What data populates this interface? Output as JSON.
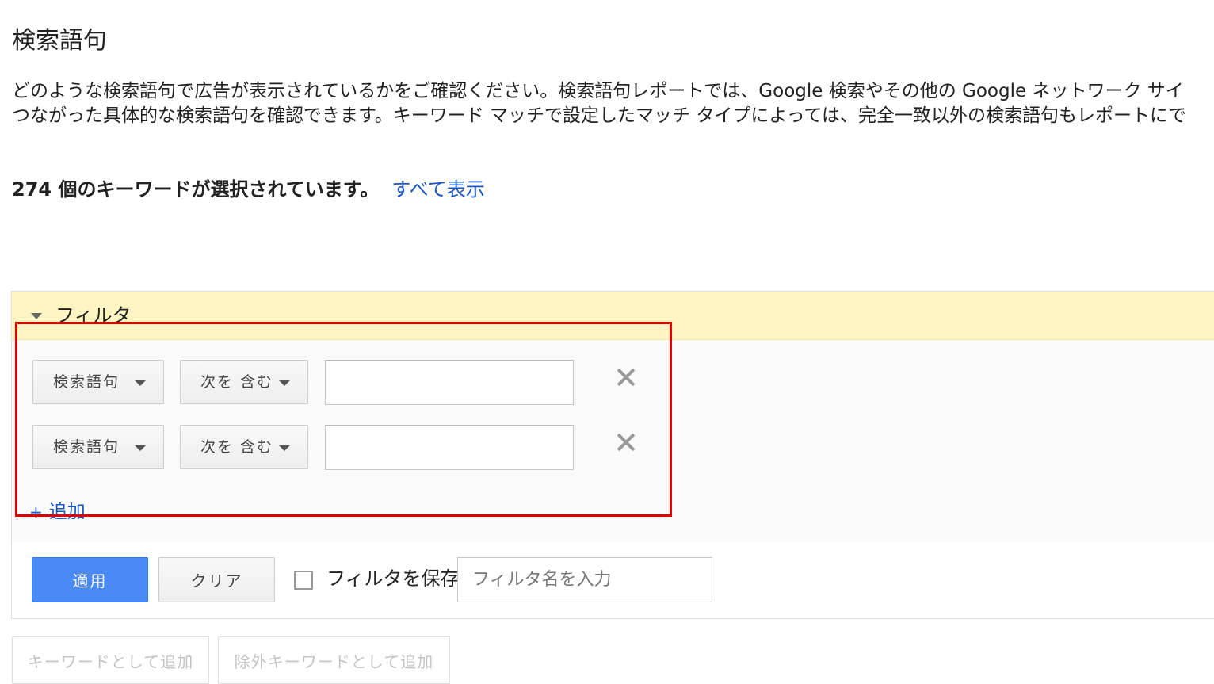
{
  "page": {
    "title": "検索語句",
    "description_lines": [
      "どのような検索語句で広告が表示されているかをご確認ください。検索語句レポートでは、Google 検索やその他の Google ネットワーク サイ",
      "つながった具体的な検索語句を確認できます。キーワード マッチで設定したマッチ タイプによっては、完全一致以外の検索語句もレポートにで"
    ],
    "selection_text": "274 個のキーワードが選択されています。",
    "show_all_link": "すべて表示"
  },
  "filter": {
    "title": "フィルタ",
    "rows": [
      {
        "field": "検索語句",
        "operator": "次を 含む",
        "value": ""
      },
      {
        "field": "検索語句",
        "operator": "次を 含む",
        "value": ""
      }
    ],
    "add_label": "追加",
    "add_prefix": "+",
    "apply_label": "適用",
    "clear_label": "クリア",
    "save_label": "フィルタを保存",
    "save_checked": false,
    "name_placeholder": "フィルタ名を入力"
  },
  "actions": {
    "add_as_keyword": "キーワードとして追加",
    "add_as_negative_keyword": "除外キーワードとして追加"
  },
  "colors": {
    "link": "#1a56c0",
    "apply_button": "#4a8af4",
    "filter_header": "#fff5c2",
    "annotation": "#e00000"
  }
}
